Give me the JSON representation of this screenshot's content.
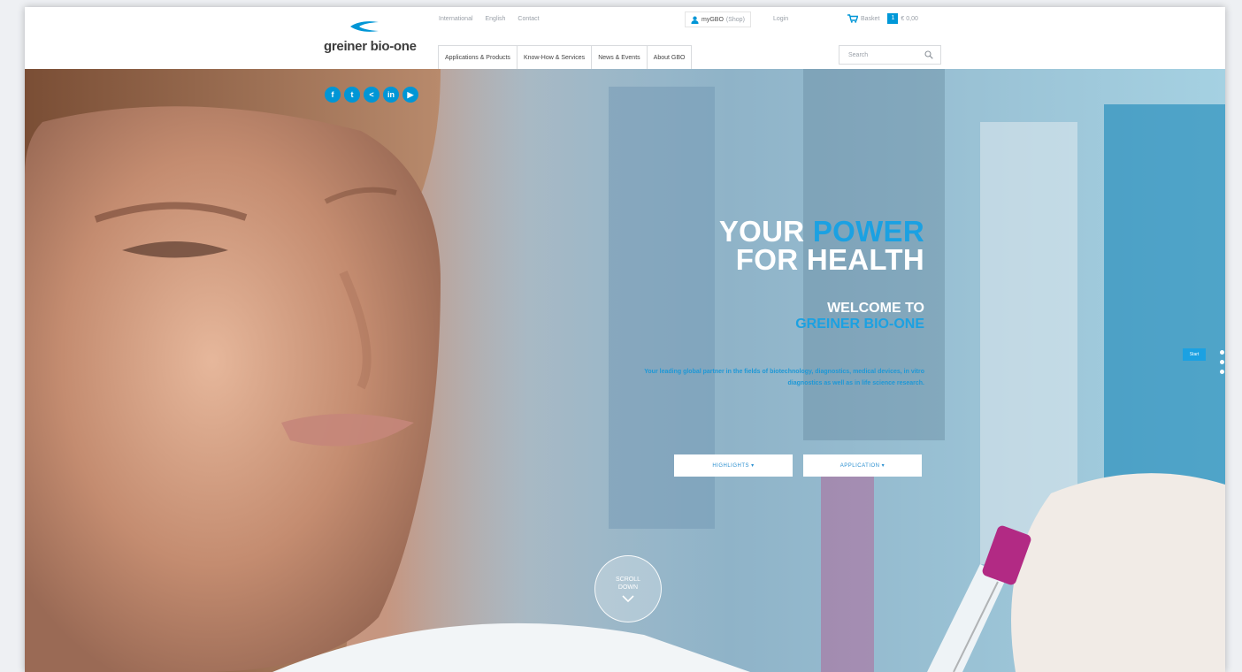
{
  "brand": {
    "logo_text": "greiner bio-one",
    "accent": "#0096d6"
  },
  "header": {
    "top_links": [
      "International",
      "English",
      "Contact"
    ],
    "mygbo": {
      "label": "myGBO",
      "shop": "(Shop)"
    },
    "login": "Login",
    "basket": {
      "label": "Basket",
      "count": "1",
      "total": "€ 0,00"
    },
    "nav": [
      "Applications & Products",
      "Know-How & Services",
      "News & Events",
      "About GBO"
    ],
    "search_placeholder": "Search"
  },
  "social": [
    "facebook-icon",
    "twitter-icon",
    "share-icon",
    "linkedin-icon",
    "youtube-icon"
  ],
  "hero": {
    "headline_line1_white": "YOUR",
    "headline_line1_blue": "POWER",
    "headline_line2": "FOR HEALTH",
    "welcome_line1": "WELCOME TO",
    "welcome_line2": "GREINER BIO-ONE",
    "subtext": "Your leading global partner in the fields of biotechnology, diagnostics, medical devices, in vitro diagnostics as well as in life science research.",
    "button_highlights": "HIGHLIGHTS ▾",
    "button_application": "APPLICATION ▾",
    "scroll_line1": "SCROLL",
    "scroll_line2": "DOWN",
    "start_tab": "Start"
  }
}
